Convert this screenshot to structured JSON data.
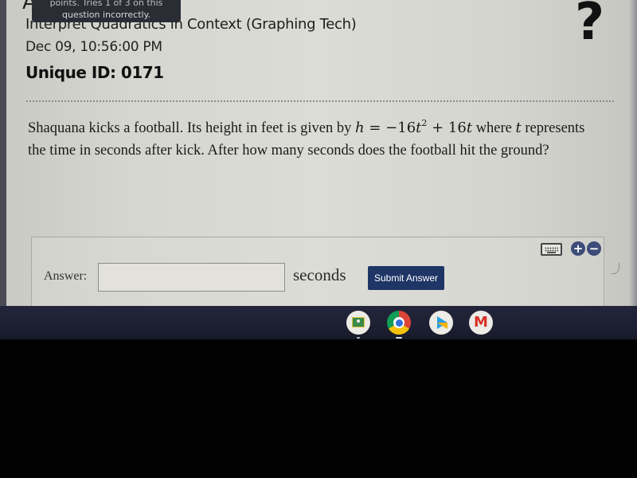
{
  "tooltip": {
    "line1": "points. Tries 1 of 3 on this",
    "line2": "question incorrectly."
  },
  "assignment": {
    "title": "Interpret Quadratics in Context (Graphing Tech)",
    "datetime": "Dec 09, 10:56:00 PM",
    "unique_id": "Unique ID: 0171"
  },
  "help_icon": "?",
  "question": {
    "text_before": "Shaquana kicks a football. Its height in feet is given by ",
    "equation": {
      "lhs": "h",
      "equals": " = ",
      "term1_sign": "−",
      "term1_coef": "16",
      "term1_var": "t",
      "term1_exp": "2",
      "plus": " + ",
      "term2_coef": "16",
      "term2_var": "t"
    },
    "text_middle": " where ",
    "var_t": "t",
    "text_after": " represents the time in seconds after kick. After how many seconds does the football hit the ground?"
  },
  "answer": {
    "label": "Answer:",
    "input_value": "",
    "input_placeholder": "",
    "unit": "seconds",
    "submit_label": "Submit Answer"
  },
  "tools": {
    "keyboard": "keyboard-icon",
    "zoom_in": "+",
    "zoom_out": "−"
  },
  "shelf": {
    "apps": [
      {
        "name": "Google Classroom",
        "icon": "classroom-icon"
      },
      {
        "name": "Google Chrome",
        "icon": "chrome-icon"
      },
      {
        "name": "Google Play Store",
        "icon": "play-store-icon"
      },
      {
        "name": "Gmail",
        "icon": "gmail-icon",
        "glyph": "M"
      }
    ]
  },
  "colors": {
    "submit_button": "#1f3566",
    "zoom_buttons": "#3d4c78",
    "tooltip_bg": "#2b2d35",
    "shelf_bg": "#1d2033"
  }
}
